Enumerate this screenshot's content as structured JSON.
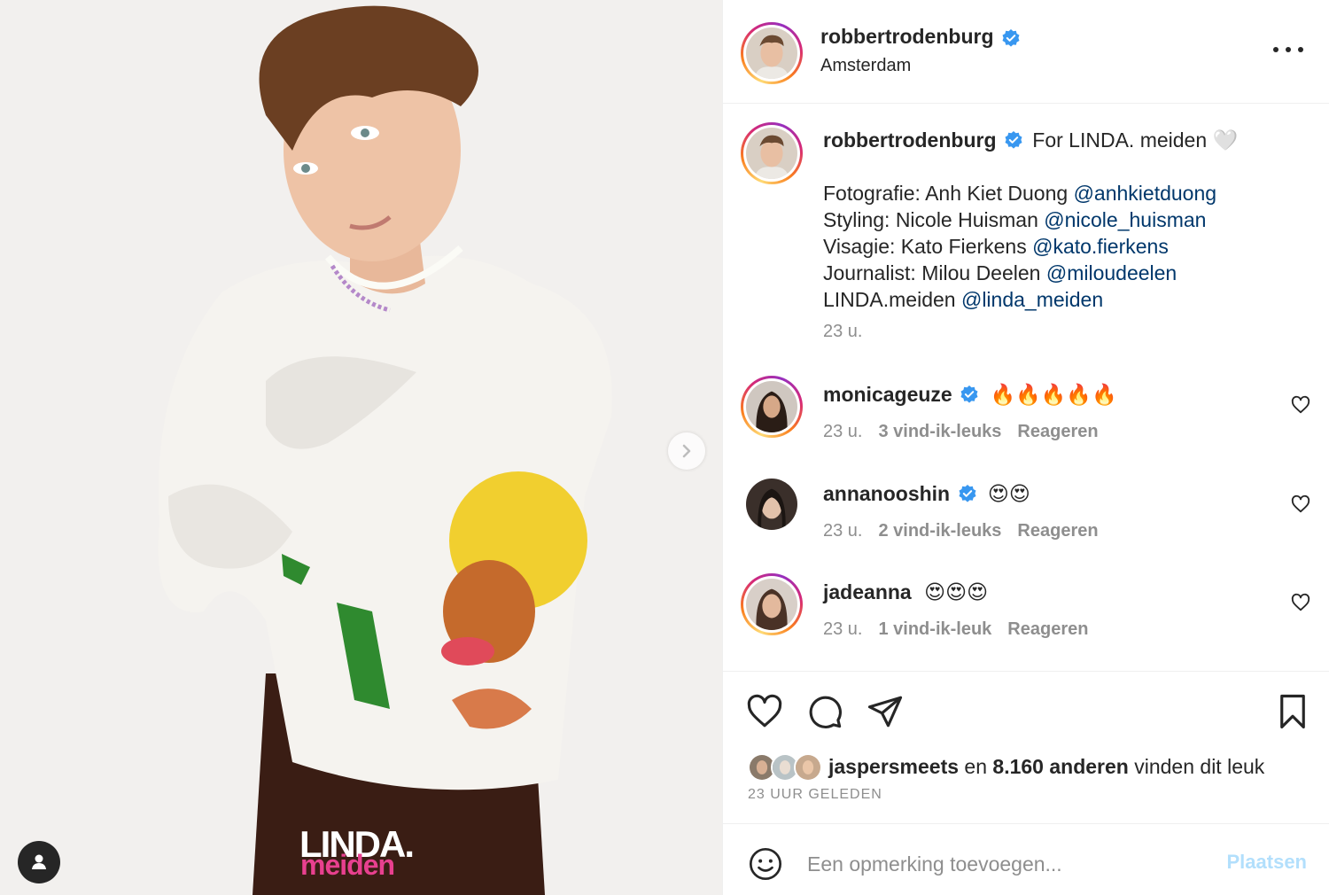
{
  "post": {
    "author": "robbertrodenburg",
    "location": "Amsterdam",
    "watermark_top": "LINDA.",
    "watermark_bottom": "meiden"
  },
  "caption": {
    "username": "robbertrodenburg",
    "text": "For LINDA. meiden 🤍",
    "credits": [
      {
        "label": "Fotografie: Anh Kiet Duong ",
        "mention": "@anhkietduong"
      },
      {
        "label": "Styling: Nicole Huisman ",
        "mention": "@nicole_huisman"
      },
      {
        "label": "Visagie: Kato Fierkens ",
        "mention": "@kato.fierkens"
      },
      {
        "label": "Journalist: Milou Deelen ",
        "mention": "@miloudeelen"
      },
      {
        "label": "LINDA.meiden ",
        "mention": "@linda_meiden"
      }
    ],
    "timestamp": "23 u."
  },
  "comments": [
    {
      "username": "monicageuze",
      "text": "🔥🔥🔥🔥🔥",
      "time": "23 u.",
      "likes": "3 vind-ik-leuks",
      "reply": "Reageren"
    },
    {
      "username": "annanooshin",
      "text": "😍😍",
      "time": "23 u.",
      "likes": "2 vind-ik-leuks",
      "reply": "Reageren"
    },
    {
      "username": "jadeanna",
      "text": "😍😍😍",
      "time": "23 u.",
      "likes": "1 vind-ik-leuk",
      "reply": "Reageren"
    }
  ],
  "likes": {
    "first_liker": "jaspersmeets",
    "connector": " en ",
    "others": "8.160 anderen",
    "suffix": " vinden dit leuk"
  },
  "posted_ago": "23 UUR GELEDEN",
  "comment_box": {
    "placeholder": "Een opmerking toevoegen...",
    "post_label": "Plaatsen"
  },
  "icons": {
    "like": "heart-icon",
    "comment": "comment-bubble-icon",
    "share": "paper-plane-icon",
    "save": "bookmark-icon",
    "emoji": "smiley-icon",
    "more": "more-horizontal-icon",
    "next": "chevron-right-icon",
    "tags": "user-tag-icon"
  },
  "colors": {
    "verified": "#3897f0",
    "mention": "#00376b",
    "meta": "#8e8e8e",
    "post_button_disabled": "#b2dffc",
    "watermark_pink": "#e8408f"
  }
}
